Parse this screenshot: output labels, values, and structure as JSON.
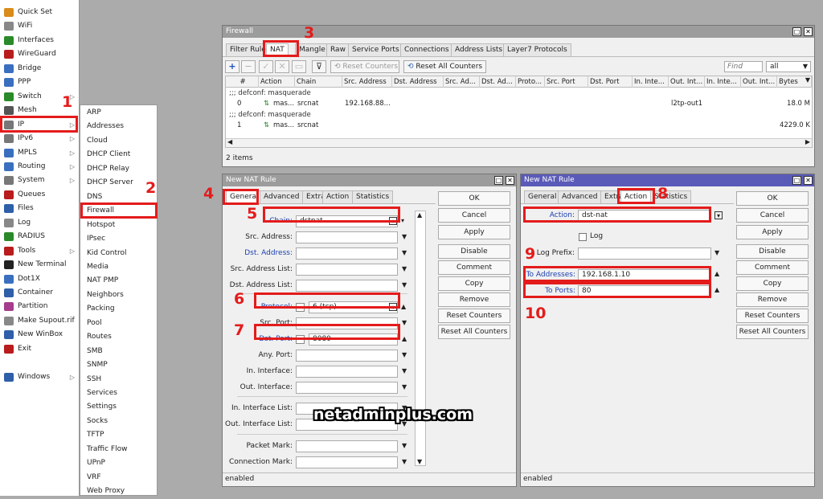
{
  "left_menu": [
    {
      "label": "Quick Set",
      "icon": "quick-set-icon",
      "color": "#d98c1a",
      "arrow": false
    },
    {
      "label": "WiFi",
      "icon": "wifi-icon",
      "color": "#888",
      "arrow": false
    },
    {
      "label": "Interfaces",
      "icon": "interfaces-icon",
      "color": "#2a8a2a",
      "arrow": false
    },
    {
      "label": "WireGuard",
      "icon": "wireguard-icon",
      "color": "#b81c1c",
      "arrow": false
    },
    {
      "label": "Bridge",
      "icon": "bridge-icon",
      "color": "#3a6fbf",
      "arrow": false
    },
    {
      "label": "PPP",
      "icon": "ppp-icon",
      "color": "#3a6fbf",
      "arrow": false
    },
    {
      "label": "Switch",
      "icon": "switch-icon",
      "color": "#2a8a2a",
      "arrow": true
    },
    {
      "label": "Mesh",
      "icon": "mesh-icon",
      "color": "#555",
      "arrow": false
    },
    {
      "label": "IP",
      "icon": "ip-icon",
      "color": "#777",
      "arrow": true
    },
    {
      "label": "IPv6",
      "icon": "ipv6-icon",
      "color": "#777",
      "arrow": true
    },
    {
      "label": "MPLS",
      "icon": "mpls-icon",
      "color": "#3a6fbf",
      "arrow": true
    },
    {
      "label": "Routing",
      "icon": "routing-icon",
      "color": "#3a6fbf",
      "arrow": true
    },
    {
      "label": "System",
      "icon": "system-icon",
      "color": "#777",
      "arrow": true
    },
    {
      "label": "Queues",
      "icon": "queues-icon",
      "color": "#b81c1c",
      "arrow": false
    },
    {
      "label": "Files",
      "icon": "files-icon",
      "color": "#2f5fa8",
      "arrow": false
    },
    {
      "label": "Log",
      "icon": "log-icon",
      "color": "#888",
      "arrow": false
    },
    {
      "label": "RADIUS",
      "icon": "radius-icon",
      "color": "#2a8a2a",
      "arrow": false
    },
    {
      "label": "Tools",
      "icon": "tools-icon",
      "color": "#b81c1c",
      "arrow": true
    },
    {
      "label": "New Terminal",
      "icon": "terminal-icon",
      "color": "#222",
      "arrow": false
    },
    {
      "label": "Dot1X",
      "icon": "dot1x-icon",
      "color": "#3a6fbf",
      "arrow": false
    },
    {
      "label": "Container",
      "icon": "container-icon",
      "color": "#2f5fa8",
      "arrow": false
    },
    {
      "label": "Partition",
      "icon": "partition-icon",
      "color": "#a53c8c",
      "arrow": false
    },
    {
      "label": "Make Supout.rif",
      "icon": "supout-icon",
      "color": "#888",
      "arrow": false
    },
    {
      "label": "New WinBox",
      "icon": "winbox-icon",
      "color": "#2f5fa8",
      "arrow": false
    },
    {
      "label": "Exit",
      "icon": "exit-icon",
      "color": "#b81c1c",
      "arrow": false
    }
  ],
  "windows_label": "Windows",
  "ip_submenu": [
    "ARP",
    "Addresses",
    "Cloud",
    "DHCP Client",
    "DHCP Relay",
    "DHCP Server",
    "DNS",
    "Firewall",
    "Hotspot",
    "IPsec",
    "Kid Control",
    "Media",
    "NAT PMP",
    "Neighbors",
    "Packing",
    "Pool",
    "Routes",
    "SMB",
    "SNMP",
    "SSH",
    "Services",
    "Settings",
    "Socks",
    "TFTP",
    "Traffic Flow",
    "UPnP",
    "VRF",
    "Web Proxy"
  ],
  "firewall": {
    "title": "Firewall",
    "tabs": [
      "Filter Rules",
      "NAT",
      "Mangle",
      "Raw",
      "Service Ports",
      "Connections",
      "Address Lists",
      "Layer7 Protocols"
    ],
    "reset_counters": "Reset Counters",
    "reset_all_counters": "Reset All Counters",
    "find_placeholder": "Find",
    "filter_value": "all",
    "columns": [
      "#",
      "Action",
      "Chain",
      "Src. Address",
      "Dst. Address",
      "Src. Ad...",
      "Dst. Ad...",
      "Proto...",
      "Src. Port",
      "Dst. Port",
      "In. Inte...",
      "Out. Int...",
      "In. Inte...",
      "Out. Int...",
      "Bytes"
    ],
    "rows": [
      {
        "comment": ";;; defconf: masquerade",
        "num": "0",
        "action": "mas...",
        "chain": "srcnat",
        "src": "192.168.88...",
        "out": "l2tp-out1",
        "bytes": "18.0 M"
      },
      {
        "comment": ";;; defconf: masquerade",
        "num": "1",
        "action": "mas...",
        "chain": "srcnat",
        "src": "",
        "out": "",
        "bytes": "4229.0 K"
      }
    ],
    "status": "2 items"
  },
  "nat_general": {
    "title": "New NAT Rule",
    "tabs": [
      "General",
      "Advanced",
      "Extra",
      "Action",
      "Statistics"
    ],
    "fields": [
      {
        "label": "Chain:",
        "value": "dstnat",
        "blue": true
      },
      {
        "label": "Src. Address:",
        "value": "",
        "blue": false
      },
      {
        "label": "Dst. Address:",
        "value": "",
        "blue": true
      },
      {
        "label": "Src. Address List:",
        "value": "",
        "blue": false
      },
      {
        "label": "Dst. Address List:",
        "value": "",
        "blue": false
      },
      {
        "label": "Protocol:",
        "value": "6 (tcp)",
        "blue": true
      },
      {
        "label": "Src. Port:",
        "value": "",
        "blue": false
      },
      {
        "label": "Dst. Port:",
        "value": "8080",
        "blue": true
      },
      {
        "label": "Any. Port:",
        "value": "",
        "blue": false
      },
      {
        "label": "In. Interface:",
        "value": "",
        "blue": false
      },
      {
        "label": "Out. Interface:",
        "value": "",
        "blue": false
      },
      {
        "label": "In. Interface List:",
        "value": "",
        "blue": false
      },
      {
        "label": "Out. Interface List:",
        "value": "",
        "blue": false
      },
      {
        "label": "Packet Mark:",
        "value": "",
        "blue": false
      },
      {
        "label": "Connection Mark:",
        "value": "",
        "blue": false
      }
    ],
    "status": "enabled"
  },
  "nat_action": {
    "title": "New NAT Rule",
    "tabs": [
      "General",
      "Advanced",
      "Extra",
      "Action",
      "Statistics"
    ],
    "action_label": "Action:",
    "action_value": "dst-nat",
    "log_label": "Log",
    "log_prefix_label": "Log Prefix:",
    "to_addresses_label": "To Addresses:",
    "to_addresses_value": "192.168.1.10",
    "to_ports_label": "To Ports:",
    "to_ports_value": "80",
    "status": "enabled"
  },
  "rule_buttons": [
    "OK",
    "Cancel",
    "Apply",
    "Disable",
    "Comment",
    "Copy",
    "Remove",
    "Reset Counters",
    "Reset All Counters"
  ],
  "step_numbers": [
    "1",
    "2",
    "3",
    "4",
    "5",
    "6",
    "7",
    "8",
    "9",
    "10"
  ],
  "watermark": "netadminplus.com",
  "highlight_color": "#e41b1b"
}
